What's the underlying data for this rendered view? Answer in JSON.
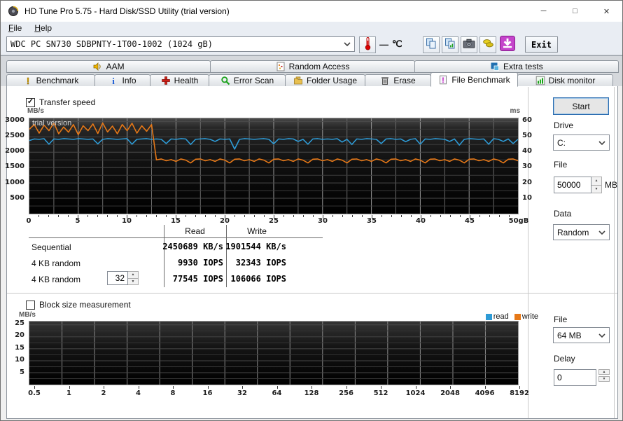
{
  "window": {
    "title": "HD Tune Pro 5.75 - Hard Disk/SSD Utility (trial version)",
    "controls": {
      "minimize": "─",
      "maximize": "□",
      "close": "✕"
    }
  },
  "menu": {
    "items": [
      {
        "label": "File"
      },
      {
        "label": "Help"
      }
    ]
  },
  "toolbar": {
    "drive_select": "WDC PC SN730 SDBPNTY-1T00-1002 (1024 gB)",
    "temperature": "—",
    "temperature_unit": "℃",
    "exit_label": "Exit",
    "icons": [
      "thermometer-icon",
      "copy-icon",
      "copy-chart-icon",
      "camera-icon",
      "save-results-icon",
      "download-icon"
    ]
  },
  "tabs": {
    "row1": [
      {
        "label": "AAM",
        "icon": "speaker-icon"
      },
      {
        "label": "Random Access",
        "icon": "random-access-icon"
      },
      {
        "label": "Extra tests",
        "icon": "extra-tests-icon"
      }
    ],
    "row2": [
      {
        "label": "Benchmark",
        "icon": "benchmark-icon"
      },
      {
        "label": "Info",
        "icon": "info-icon"
      },
      {
        "label": "Health",
        "icon": "health-icon"
      },
      {
        "label": "Error Scan",
        "icon": "error-scan-icon"
      },
      {
        "label": "Folder Usage",
        "icon": "folder-icon"
      },
      {
        "label": "Erase",
        "icon": "erase-icon"
      },
      {
        "label": "File Benchmark",
        "icon": "file-benchmark-icon",
        "active": true
      },
      {
        "label": "Disk monitor",
        "icon": "disk-monitor-icon"
      }
    ],
    "active_tab": "File Benchmark"
  },
  "file_benchmark": {
    "transfer_speed_label": "Transfer speed",
    "trial_watermark": "trial version",
    "table": {
      "headers": [
        "Read",
        "Write"
      ],
      "rows": [
        {
          "label": "Sequential",
          "read": "2450689 KB/s",
          "write": "1901544 KB/s"
        },
        {
          "label": "4 KB random",
          "read": "9930 IOPS",
          "write": "32343 IOPS"
        },
        {
          "label": "4 KB random",
          "queue_depth": "32",
          "read": "77545 IOPS",
          "write": "106066 IOPS"
        }
      ]
    },
    "block_size_label": "Block size measurement",
    "legend": [
      {
        "label": "read",
        "color": "#2e9bd6"
      },
      {
        "label": "write",
        "color": "#e67817"
      }
    ]
  },
  "side_panel": {
    "start_label": "Start",
    "drive_label": "Drive",
    "drive_value": "C:",
    "file_label": "File",
    "file_size_value": "50000",
    "file_size_unit": "MB",
    "data_label": "Data",
    "data_value": "Random",
    "block_file_label": "File",
    "block_file_value": "64 MB",
    "delay_label": "Delay",
    "delay_value": "0"
  },
  "chart_data": [
    {
      "type": "line",
      "title": "Transfer speed",
      "ylabel_left": "MB/s",
      "ylabel_right": "ms",
      "y_ticks_left": [
        3000,
        2500,
        2000,
        1500,
        1000,
        500
      ],
      "y_ticks_right": [
        60,
        50,
        40,
        30,
        20,
        10
      ],
      "ylim_left": [
        0,
        3100
      ],
      "ylim_right": [
        0,
        62
      ],
      "xlim": [
        0,
        50
      ],
      "x_ticks": [
        "0",
        "5",
        "10",
        "15",
        "20",
        "25",
        "30",
        "35",
        "40",
        "45",
        "50gB"
      ],
      "x_step": 0.5,
      "grid": true,
      "series": [
        {
          "name": "read",
          "color": "#2e9bd6",
          "unit": "MB/s",
          "values": [
            2380,
            2430,
            2420,
            2440,
            2260,
            2430,
            2420,
            2440,
            2430,
            2420,
            2440,
            2430,
            2420,
            2430,
            2270,
            2420,
            2440,
            2430,
            2420,
            2430,
            2440,
            2260,
            2420,
            2430,
            2440,
            2420,
            2430,
            2420,
            2280,
            2430,
            2420,
            2440,
            2430,
            2250,
            2420,
            2430,
            2440,
            2420,
            2350,
            2430,
            2420,
            2430,
            2100,
            2420,
            2440,
            2430,
            2420,
            2430,
            2440,
            2420,
            2270,
            2430,
            2420,
            2440,
            2430,
            2350,
            2420,
            2260,
            2430,
            2440,
            2420,
            2430,
            2420,
            2440,
            2330,
            2420,
            2250,
            2430,
            2420,
            2440,
            2430,
            2420,
            2280,
            2430,
            2440,
            2420,
            2430,
            2340,
            2420,
            2440,
            2260,
            2430,
            2420,
            2440,
            2430,
            2420,
            2350,
            2430,
            2230,
            2420,
            2440,
            2430,
            2420,
            2430,
            2260,
            2440,
            2420,
            2350,
            2430,
            2280,
            2420
          ]
        },
        {
          "name": "write",
          "color": "#e67817",
          "unit": "MB/s",
          "values": [
            2750,
            2900,
            2620,
            2880,
            2700,
            2950,
            2600,
            2820,
            2650,
            2900,
            2570,
            2860,
            2700,
            2920,
            2610,
            2950,
            2660,
            2850,
            2600,
            2900,
            2700,
            2940,
            2620,
            2860,
            2680,
            2900,
            1750,
            1780,
            1720,
            1760,
            1700,
            1780,
            1740,
            1650,
            1770,
            1780,
            1720,
            1760,
            1700,
            1780,
            1740,
            1650,
            1770,
            1780,
            1720,
            1760,
            1700,
            1780,
            1740,
            1650,
            1770,
            1780,
            1720,
            1760,
            1700,
            1780,
            1740,
            1650,
            1770,
            1780,
            1720,
            1760,
            1700,
            1780,
            1740,
            1650,
            1770,
            1780,
            1720,
            1760,
            1700,
            1780,
            1740,
            1650,
            1770,
            1780,
            1720,
            1760,
            1700,
            1780,
            1740,
            1650,
            1770,
            1780,
            1720,
            1760,
            1700,
            1780,
            1740,
            1650,
            1770,
            1780,
            1720,
            1760,
            1700,
            1780,
            1740,
            1650,
            1770,
            1780,
            1720
          ]
        }
      ]
    },
    {
      "type": "line",
      "title": "Block size measurement",
      "ylabel": "MB/s",
      "y_ticks": [
        25,
        20,
        15,
        10,
        5
      ],
      "ylim": [
        0,
        26.4
      ],
      "x_ticks": [
        "0.5",
        "1",
        "2",
        "4",
        "8",
        "16",
        "32",
        "64",
        "128",
        "256",
        "512",
        "1024",
        "2048",
        "4096",
        "8192"
      ],
      "grid": true,
      "series": []
    }
  ]
}
